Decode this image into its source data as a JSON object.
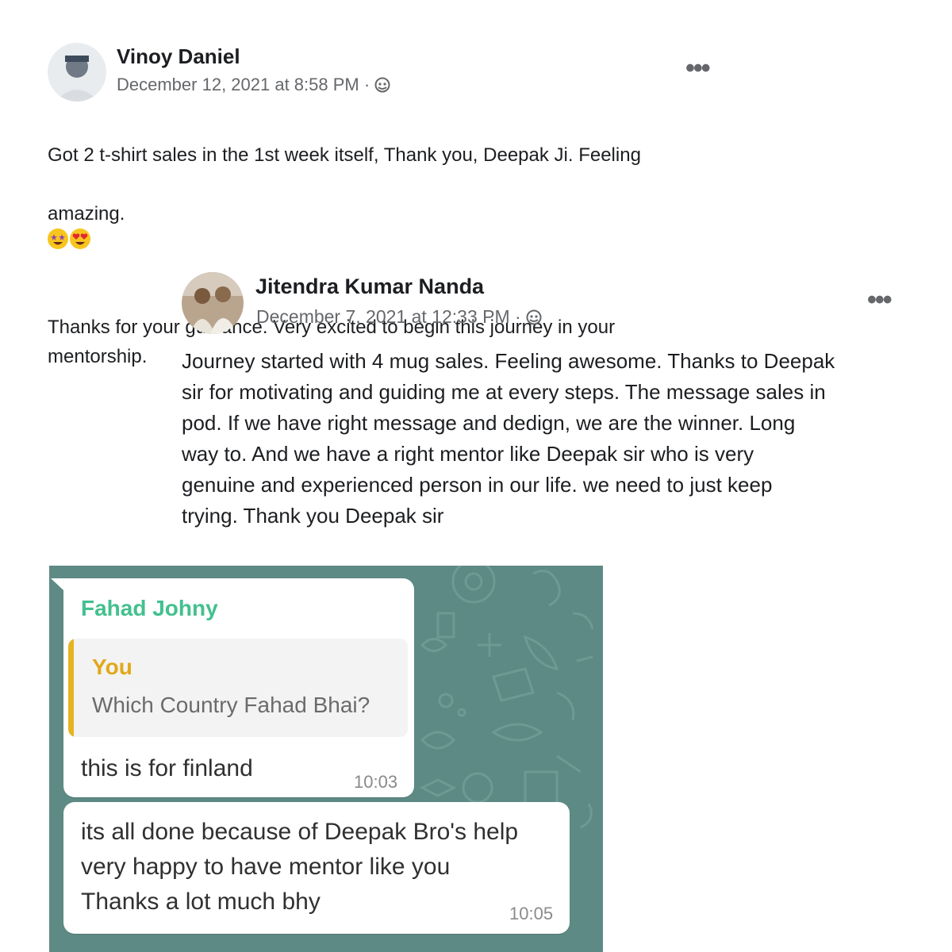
{
  "post1": {
    "name": "Vinoy Daniel",
    "date": "December 12, 2021 at 8:58 PM ·",
    "more": "•••",
    "text_line1": "Got 2 t-shirt sales in the 1st week itself, Thank you, Deepak Ji. Feeling",
    "text_line2": "amazing.",
    "text_rest": "Thanks for your guidance. Very excited to begin this journey in your\nmentorship.",
    "emojis": [
      "star-struck-emoji",
      "heart-eyes-emoji"
    ]
  },
  "post2": {
    "name": "Jitendra Kumar Nanda",
    "date": "December 7, 2021 at 12:33 PM ·",
    "more": "•••",
    "text": "Journey started with 4 mug sales. Feeling awesome. Thanks to Deepak\nsir for motivating and guiding me at every steps. The message sales in\npod. If we have right message and dedign, we are the winner. Long\nway to. And we have a right mentor like Deepak sir who is very\ngenuine and experienced person in our life. we need to just keep\ntrying. Thank you Deepak sir"
  },
  "chat": {
    "message1": {
      "sender": "Fahad Johny",
      "quote_author": "You",
      "quote_text": "Which Country Fahad Bhai?",
      "text": "this is for finland",
      "time": "10:03"
    },
    "message2": {
      "text": "its all done because of Deepak Bro's help\nvery happy to have mentor like you\nThanks a lot much bhy",
      "time": "10:05"
    },
    "colors": {
      "background": "#5d8a84",
      "sender": "#43c08f",
      "quote_accent": "#e6b422"
    }
  }
}
